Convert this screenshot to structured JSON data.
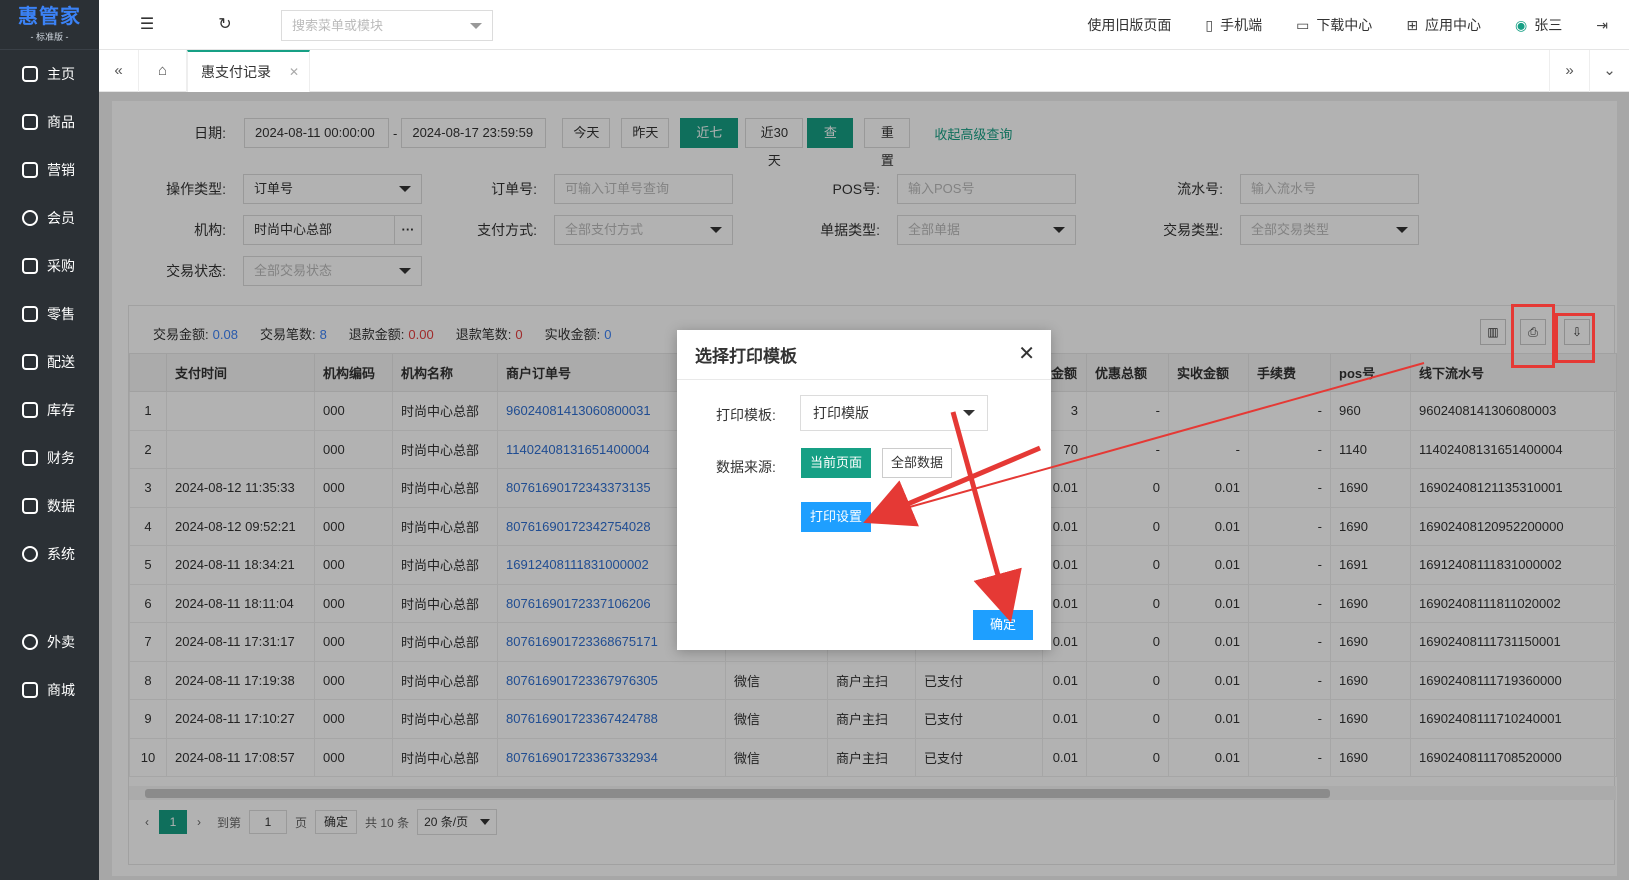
{
  "logo": {
    "main": "惠管家",
    "sub": "- 标准版 -"
  },
  "sidebar": {
    "items": [
      {
        "label": "主页",
        "icon": "home-icon"
      },
      {
        "label": "商品",
        "icon": "box-icon"
      },
      {
        "label": "营销",
        "icon": "chart-icon"
      },
      {
        "label": "会员",
        "icon": "heart-icon"
      },
      {
        "label": "采购",
        "icon": "receipt-icon"
      },
      {
        "label": "零售",
        "icon": "bag-icon"
      },
      {
        "label": "配送",
        "icon": "truck-icon"
      },
      {
        "label": "库存",
        "icon": "warehouse-icon"
      },
      {
        "label": "财务",
        "icon": "finance-icon"
      },
      {
        "label": "数据",
        "icon": "data-icon"
      },
      {
        "label": "系统",
        "icon": "settings-icon"
      },
      {
        "label": "外卖",
        "icon": "takeout-icon"
      },
      {
        "label": "商城",
        "icon": "mall-icon"
      }
    ]
  },
  "topbar": {
    "search_placeholder": "搜索菜单或模块",
    "old_page": "使用旧版页面",
    "mobile": "手机端",
    "download": "下载中心",
    "apps": "应用中心",
    "user": "张三"
  },
  "tabs": {
    "active": "惠支付记录"
  },
  "filters": {
    "date_label": "日期:",
    "date_start": "2024-08-11 00:00:00",
    "date_sep": "-",
    "date_end": "2024-08-17 23:59:59",
    "btn_today": "今天",
    "btn_yesterday": "昨天",
    "btn_7days": "近七天",
    "btn_30days": "近30天",
    "btn_query": "查询",
    "btn_reset": "重置",
    "collapse": "收起高级查询",
    "op_type_label": "操作类型:",
    "op_type_value": "订单号",
    "order_label": "订单号:",
    "order_placeholder": "可输入订单号查询",
    "pos_label": "POS号:",
    "pos_placeholder": "输入POS号",
    "serial_label": "流水号:",
    "serial_placeholder": "输入流水号",
    "org_label": "机构:",
    "org_value": "时尚中心总部",
    "org_more": "···",
    "pay_label": "支付方式:",
    "pay_value": "全部支付方式",
    "doc_label": "单据类型:",
    "doc_value": "全部单据",
    "trade_label": "交易类型:",
    "trade_value": "全部交易类型",
    "status_label": "交易状态:",
    "status_value": "全部交易状态"
  },
  "summary": {
    "amount_label": "交易金额:",
    "amount": "0.08",
    "count_label": "交易笔数:",
    "count": "8",
    "refund_label": "退款金额:",
    "refund": "0.00",
    "refund_count_label": "退款笔数:",
    "refund_count": "0",
    "actual_label": "实收金额:",
    "actual": "0"
  },
  "table": {
    "headers": [
      "",
      "支付时间",
      "机构编码",
      "机构名称",
      "商户订单号",
      "",
      "",
      "",
      "金额",
      "优惠总额",
      "实收金额",
      "手续费",
      "pos号",
      "线下流水号"
    ],
    "rows": [
      [
        "1",
        "",
        "000",
        "时尚中心总部",
        "96024081413060800031",
        "",
        "",
        "",
        "3",
        "-",
        "",
        "-",
        "960",
        "9602408141306080003"
      ],
      [
        "2",
        "",
        "000",
        "时尚中心总部",
        "11402408131651400004",
        "",
        "",
        "",
        "70",
        "-",
        "-",
        "-",
        "1140",
        "11402408131651400004"
      ],
      [
        "3",
        "2024-08-12 11:35:33",
        "000",
        "时尚中心总部",
        "80761690172343373135",
        "",
        "",
        "",
        "0.01",
        "0",
        "0.01",
        "-",
        "1690",
        "16902408121135310001"
      ],
      [
        "4",
        "2024-08-12 09:52:21",
        "000",
        "时尚中心总部",
        "80761690172342754028",
        "",
        "",
        "",
        "0.01",
        "0",
        "0.01",
        "-",
        "1690",
        "16902408120952200000"
      ],
      [
        "5",
        "2024-08-11 18:34:21",
        "000",
        "时尚中心总部",
        "16912408111831000002",
        "",
        "",
        "",
        "0.01",
        "0",
        "0.01",
        "-",
        "1691",
        "16912408111831000002"
      ],
      [
        "6",
        "2024-08-11 18:11:04",
        "000",
        "时尚中心总部",
        "80761690172337106206",
        "",
        "",
        "",
        "0.01",
        "0",
        "0.01",
        "-",
        "1690",
        "16902408111811020002"
      ],
      [
        "7",
        "2024-08-11 17:31:17",
        "000",
        "时尚中心总部",
        "807616901723368675171",
        "微信",
        "商户主扫",
        "已支付",
        "0.01",
        "0",
        "0.01",
        "-",
        "1690",
        "16902408111731150001"
      ],
      [
        "8",
        "2024-08-11 17:19:38",
        "000",
        "时尚中心总部",
        "807616901723367976305",
        "微信",
        "商户主扫",
        "已支付",
        "0.01",
        "0",
        "0.01",
        "-",
        "1690",
        "16902408111719360000"
      ],
      [
        "9",
        "2024-08-11 17:10:27",
        "000",
        "时尚中心总部",
        "807616901723367424788",
        "微信",
        "商户主扫",
        "已支付",
        "0.01",
        "0",
        "0.01",
        "-",
        "1690",
        "16902408111710240001"
      ],
      [
        "10",
        "2024-08-11 17:08:57",
        "000",
        "时尚中心总部",
        "807616901723367332934",
        "微信",
        "商户主扫",
        "已支付",
        "0.01",
        "0",
        "0.01",
        "-",
        "1690",
        "16902408111708520000"
      ]
    ]
  },
  "pager": {
    "current": "1",
    "goto": "到第",
    "page_value": "1",
    "page_unit": "页",
    "confirm": "确定",
    "total": "共 10 条",
    "per_page": "20 条/页"
  },
  "modal": {
    "title": "选择打印模板",
    "template_label": "打印模板:",
    "template_value": "打印模版",
    "source_label": "数据来源:",
    "btn_current": "当前页面",
    "btn_all": "全部数据",
    "btn_settings": "打印设置",
    "btn_ok": "确定"
  },
  "colors": {
    "accent": "#16a085",
    "sidebar": "#2b3035",
    "link": "#2f6fd1",
    "annotation": "#e53935"
  }
}
